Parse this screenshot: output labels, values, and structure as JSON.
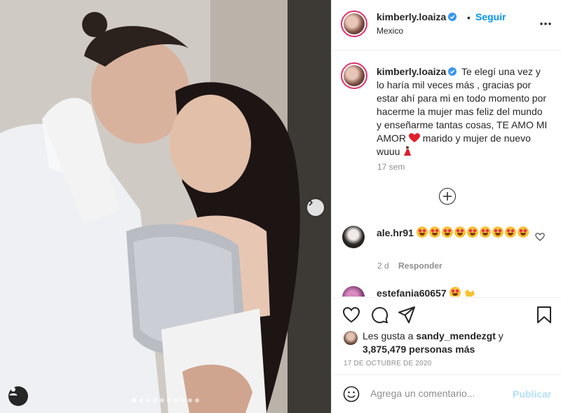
{
  "post": {
    "username": "kimberly.loaiza",
    "follow_label": "Seguir",
    "location": "Mexico",
    "bullet": "•"
  },
  "caption": {
    "username": "kimberly.loaiza",
    "text_before_heart": "Te elegí una vez y lo haría mil veces más , gracias por estar ahí para mi en todo momento por hacerme la mujer mas feliz del mundo y enseñarme tantas cosas, TE AMO MI AMOR",
    "text_after_heart": "marido y mujer de nuevo wuuu",
    "time": "17 sem"
  },
  "comments": [
    {
      "username": "ale.hr91",
      "emoji_count": 9,
      "time": "2 d",
      "reply_label": "Responder"
    },
    {
      "username": "estefania60657"
    }
  ],
  "likes": {
    "prefix": "Les gusta a",
    "user": "sandy_mendezgt",
    "conjunction": "y",
    "count_text": "3,875,479 personas más"
  },
  "date": "17 DE OCTUBRE DE 2020",
  "comment_box": {
    "placeholder": "Agrega un comentario...",
    "publish_label": "Publicar"
  },
  "carousel": {
    "total": 10,
    "active_index": 0
  },
  "colors": {
    "link": "#0095f6",
    "publish_disabled": "#b2dffc",
    "muted": "#8e8e8e",
    "heart": "#ed4956"
  },
  "icons": [
    "verified-badge-icon",
    "more-options-icon",
    "plus-circle-icon",
    "heart-icon",
    "comment-icon",
    "share-icon",
    "bookmark-icon",
    "emoji-icon",
    "chevron-right-icon",
    "user-tag-icon"
  ]
}
